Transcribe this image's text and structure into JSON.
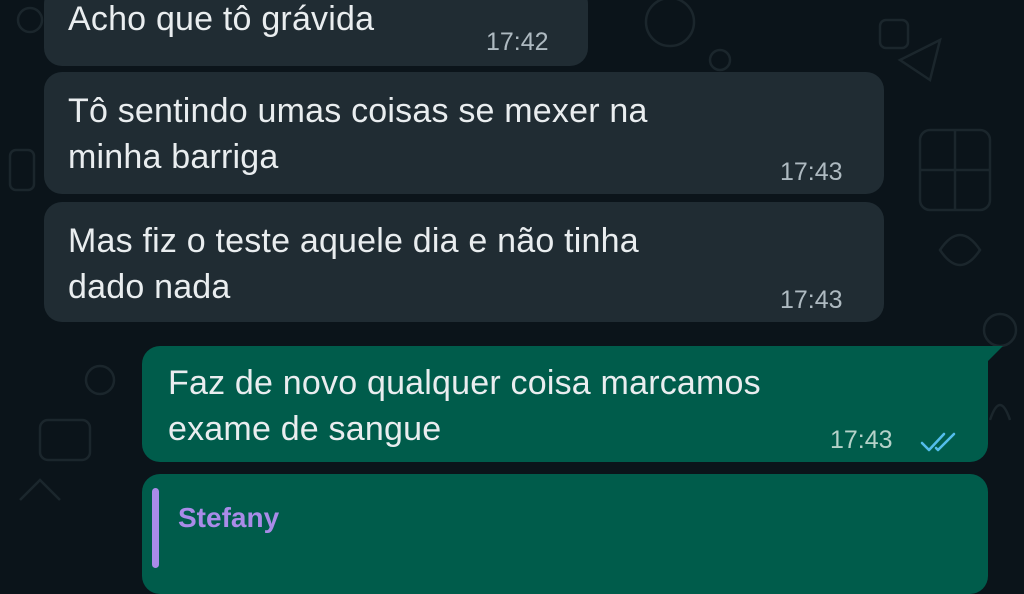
{
  "chat": {
    "messages": [
      {
        "direction": "incoming",
        "text": "Acho que tô grávida",
        "time": "17:42"
      },
      {
        "direction": "incoming",
        "text": "Tô sentindo umas coisas se mexer na\nminha barriga",
        "time": "17:43"
      },
      {
        "direction": "incoming",
        "text": "Mas fiz o teste aquele dia e não tinha\ndado nada",
        "time": "17:43"
      },
      {
        "direction": "outgoing",
        "text": "Faz de novo qualquer coisa marcamos\nexame de sangue",
        "time": "17:43",
        "status_icon": "double-check-read-icon"
      },
      {
        "direction": "outgoing",
        "quoted_sender": "Stefany"
      }
    ]
  },
  "colors": {
    "background": "#0b141a",
    "incoming_bubble": "#202c33",
    "outgoing_bubble": "#005c4b",
    "read_ticks": "#53bdeb",
    "quote_accent": "#a98be8"
  }
}
